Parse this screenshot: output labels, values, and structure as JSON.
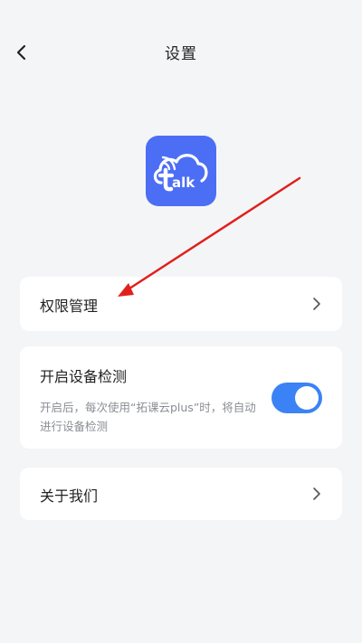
{
  "header": {
    "title": "设置",
    "back_icon": "chevron-left-icon"
  },
  "app": {
    "logo_text": "talk",
    "logo_color": "#4c6ef5"
  },
  "settings": {
    "permissions": {
      "label": "权限管理",
      "icon": "chevron-right-icon"
    },
    "device_detection": {
      "label": "开启设备检测",
      "description": "开启后，每次使用“拓课云plus”时，将自动进行设备检测",
      "enabled": true,
      "toggle_color": "#3b82f6"
    },
    "about": {
      "label": "关于我们",
      "icon": "chevron-right-icon"
    }
  },
  "annotation": {
    "arrow_color": "#e0201b"
  }
}
